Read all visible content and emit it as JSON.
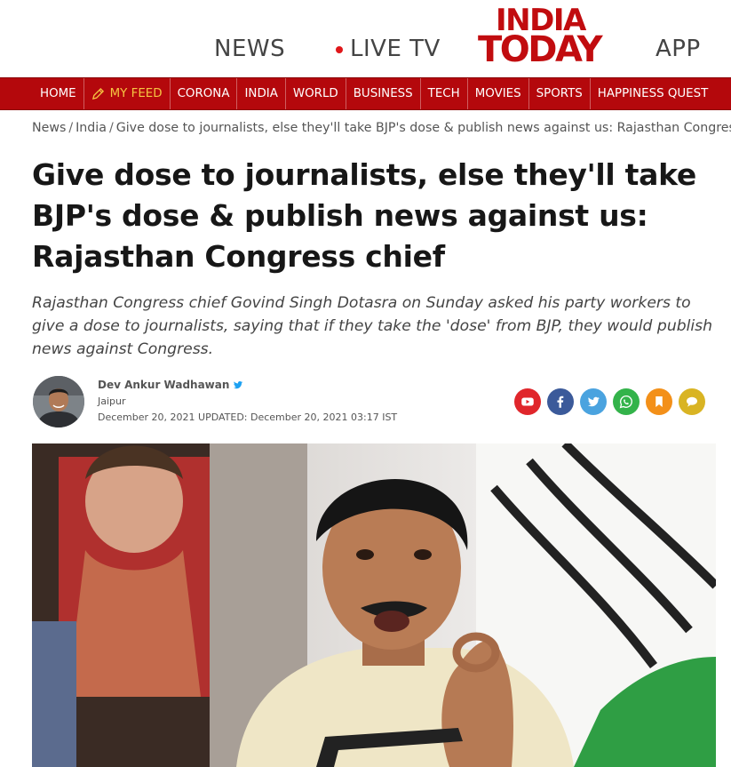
{
  "header": {
    "news_label": "NEWS",
    "live_label": "LIVE TV",
    "logo_line1": "INDIA",
    "logo_line2": "TODAY",
    "app_label": "APP",
    "brand_color": "#b4080c"
  },
  "nav": {
    "items": [
      {
        "label": "HOME"
      },
      {
        "label": "MY FEED",
        "icon": "pencil-icon"
      },
      {
        "label": "CORONA"
      },
      {
        "label": "INDIA"
      },
      {
        "label": "WORLD"
      },
      {
        "label": "BUSINESS"
      },
      {
        "label": "TECH"
      },
      {
        "label": "MOVIES"
      },
      {
        "label": "SPORTS"
      },
      {
        "label": "HAPPINESS QUEST"
      }
    ]
  },
  "breadcrumb": {
    "items": [
      "News",
      "India",
      "Give dose to journalists, else they'll take BJP's dose & publish news against us: Rajasthan Congress"
    ],
    "separator": "/"
  },
  "article": {
    "title": "Give dose to journalists, else they'll take BJP's dose & publish news against us: Rajasthan Congress chief",
    "summary": "Rajasthan Congress chief Govind Singh Dotasra on Sunday asked his party workers to give a dose to journalists, saying that if they take the 'dose' from BJP, they would publish news against Congress.",
    "author": "Dev Ankur Wadhawan",
    "location": "Jaipur",
    "date": "December 20, 2021  UPDATED: December 20, 2021 03:17 IST"
  },
  "share": [
    {
      "name": "youtube",
      "icon": "youtube-icon",
      "color": "#e0262b"
    },
    {
      "name": "facebook",
      "icon": "facebook-icon",
      "color": "#3b5a9a"
    },
    {
      "name": "twitter",
      "icon": "twitter-icon",
      "color": "#4aa3df"
    },
    {
      "name": "whatsapp",
      "icon": "whatsapp-icon",
      "color": "#33b34a"
    },
    {
      "name": "bookmark",
      "icon": "bookmark-icon",
      "color": "#f39019"
    },
    {
      "name": "comment",
      "icon": "comment-icon",
      "color": "#d9b423"
    }
  ]
}
